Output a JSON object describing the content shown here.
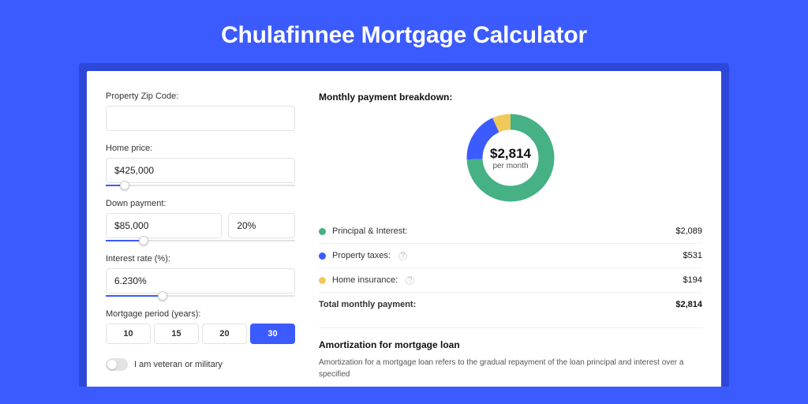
{
  "title": "Chulafinnee Mortgage Calculator",
  "form": {
    "zip_label": "Property Zip Code:",
    "zip_value": "",
    "home_price_label": "Home price:",
    "home_price_value": "$425,000",
    "home_price_slider_pct": 10,
    "down_label": "Down payment:",
    "down_value": "$85,000",
    "down_pct": "20%",
    "down_slider_pct": 20,
    "rate_label": "Interest rate (%):",
    "rate_value": "6.230%",
    "rate_slider_pct": 30,
    "period_label": "Mortgage period (years):",
    "period_options": [
      "10",
      "15",
      "20",
      "30"
    ],
    "period_selected": "30",
    "veteran_label": "I am veteran or military",
    "veteran_on": false
  },
  "breakdown": {
    "title": "Monthly payment breakdown:",
    "center_value": "$2,814",
    "center_sub": "per month",
    "items": [
      {
        "label": "Principal & Interest:",
        "value": "$2,089",
        "color": "#45b184",
        "has_info": false
      },
      {
        "label": "Property taxes:",
        "value": "$531",
        "color": "#3b5bff",
        "has_info": true
      },
      {
        "label": "Home insurance:",
        "value": "$194",
        "color": "#f1c95b",
        "has_info": true
      }
    ],
    "total_label": "Total monthly payment:",
    "total_value": "$2,814"
  },
  "chart_data": {
    "type": "pie",
    "title": "Monthly payment breakdown",
    "series": [
      {
        "name": "Principal & Interest",
        "value": 2089,
        "color": "#45b184"
      },
      {
        "name": "Property taxes",
        "value": 531,
        "color": "#3b5bff"
      },
      {
        "name": "Home insurance",
        "value": 194,
        "color": "#f1c95b"
      }
    ],
    "total": 2814
  },
  "amortization": {
    "title": "Amortization for mortgage loan",
    "text": "Amortization for a mortgage loan refers to the gradual repayment of the loan principal and interest over a specified"
  }
}
